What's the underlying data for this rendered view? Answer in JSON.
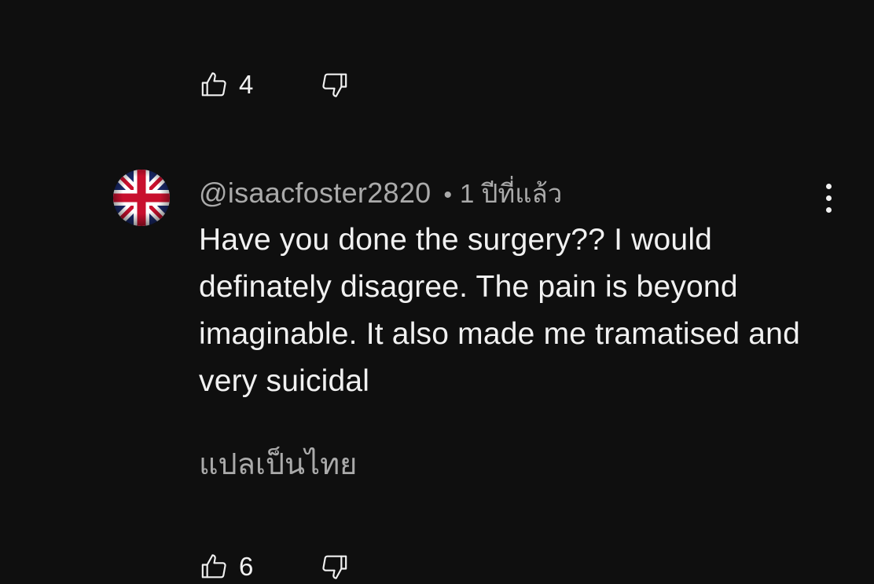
{
  "previous_comment": {
    "like_count": "4"
  },
  "comment": {
    "author": "@isaacfoster2820",
    "separator": "•",
    "timestamp": "1 ปีที่แล้ว",
    "text": "Have you done the surgery?? I would definately disagree. The pain is beyond imaginable. It also made me tramatised and very suicidal",
    "translate_label": "แปลเป็นไทย",
    "like_count": "6",
    "avatar": "union-jack-flag"
  },
  "icons": {
    "like": "thumbs-up-icon",
    "dislike": "thumbs-down-icon",
    "menu": "more-vertical-icon"
  },
  "colors": {
    "background": "#0f0f0f",
    "text_primary": "#f1f1f1",
    "text_secondary": "#aaaaaa"
  }
}
